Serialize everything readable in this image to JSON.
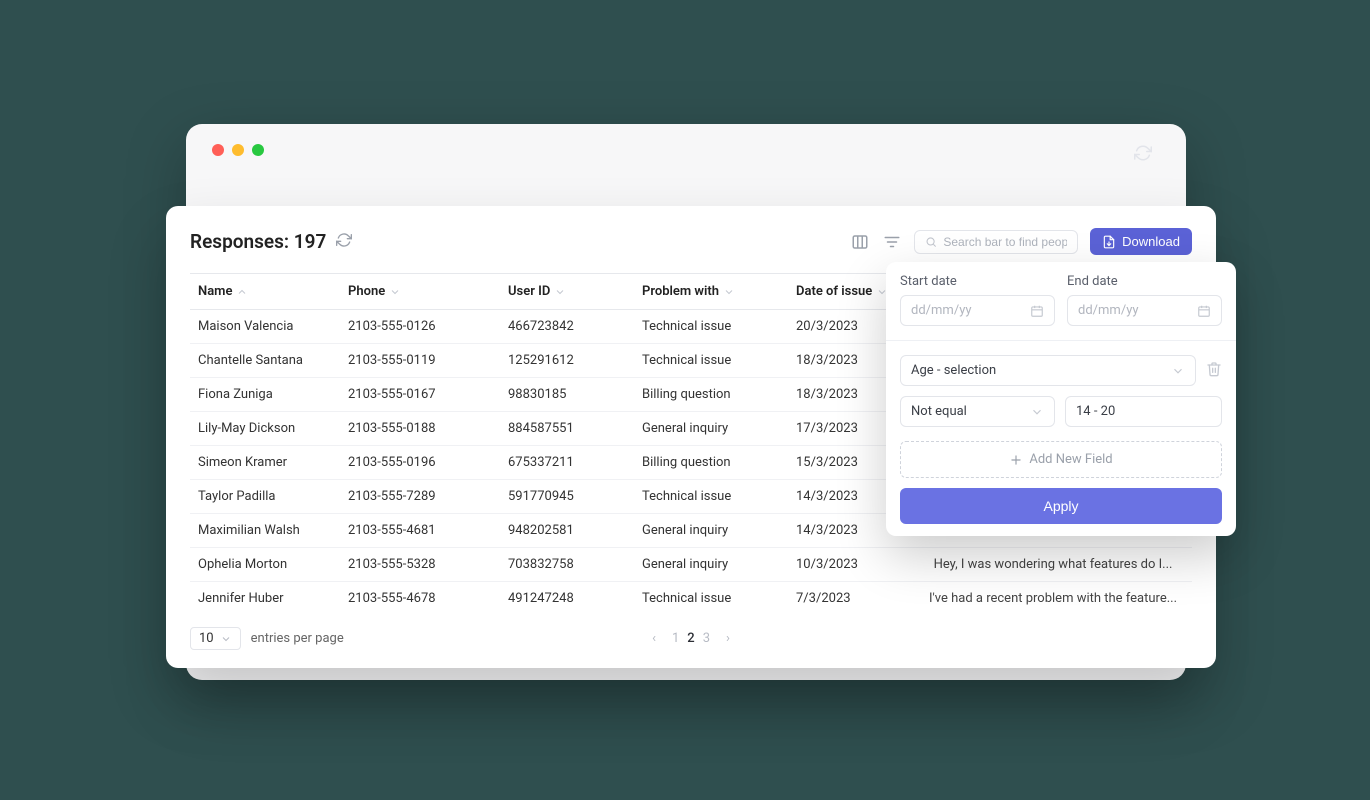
{
  "header": {
    "title_prefix": "Responses:",
    "count": "197"
  },
  "toolbar": {
    "search_placeholder": "Search bar to find people",
    "download_label": "Download"
  },
  "columns": {
    "name": "Name",
    "phone": "Phone",
    "user_id": "User ID",
    "problem": "Problem with",
    "date": "Date of issue"
  },
  "rows": [
    {
      "name": "Maison Valencia",
      "phone": "2103-555-0126",
      "user_id": "466723842",
      "problem": "Technical issue",
      "date": "20/3/2023",
      "msg": ""
    },
    {
      "name": "Chantelle Santana",
      "phone": "2103-555-0119",
      "user_id": "125291612",
      "problem": "Technical issue",
      "date": "18/3/2023",
      "msg": ""
    },
    {
      "name": "Fiona Zuniga",
      "phone": "2103-555-0167",
      "user_id": "98830185",
      "problem": "Billing question",
      "date": "18/3/2023",
      "msg": ""
    },
    {
      "name": "Lily-May Dickson",
      "phone": "2103-555-0188",
      "user_id": "884587551",
      "problem": "General inquiry",
      "date": "17/3/2023",
      "msg": ""
    },
    {
      "name": "Simeon Kramer",
      "phone": "2103-555-0196",
      "user_id": "675337211",
      "problem": "Billing question",
      "date": "15/3/2023",
      "msg": ""
    },
    {
      "name": "Taylor Padilla",
      "phone": "2103-555-7289",
      "user_id": "591770945",
      "problem": "Technical issue",
      "date": "14/3/2023",
      "msg": ""
    },
    {
      "name": "Maximilian Walsh",
      "phone": "2103-555-4681",
      "user_id": "948202581",
      "problem": "General inquiry",
      "date": "14/3/2023",
      "msg": ""
    },
    {
      "name": "Ophelia Morton",
      "phone": "2103-555-5328",
      "user_id": "703832758",
      "problem": "General inquiry",
      "date": "10/3/2023",
      "msg": "Hey, I was wondering what features do I..."
    },
    {
      "name": "Jennifer Huber",
      "phone": "2103-555-4678",
      "user_id": "491247248",
      "problem": "Technical issue",
      "date": "7/3/2023",
      "msg": "I've had a recent problem with the feature..."
    }
  ],
  "footer": {
    "entries_value": "10",
    "entries_label": "entries per page",
    "pages": [
      "1",
      "2",
      "3"
    ],
    "current_page": "2"
  },
  "filter": {
    "start_label": "Start date",
    "end_label": "End date",
    "date_placeholder": "dd/mm/yy",
    "field_selection": "Age - selection",
    "operator": "Not equal",
    "value": "14 - 20",
    "add_field_label": "Add New Field",
    "apply_label": "Apply"
  }
}
